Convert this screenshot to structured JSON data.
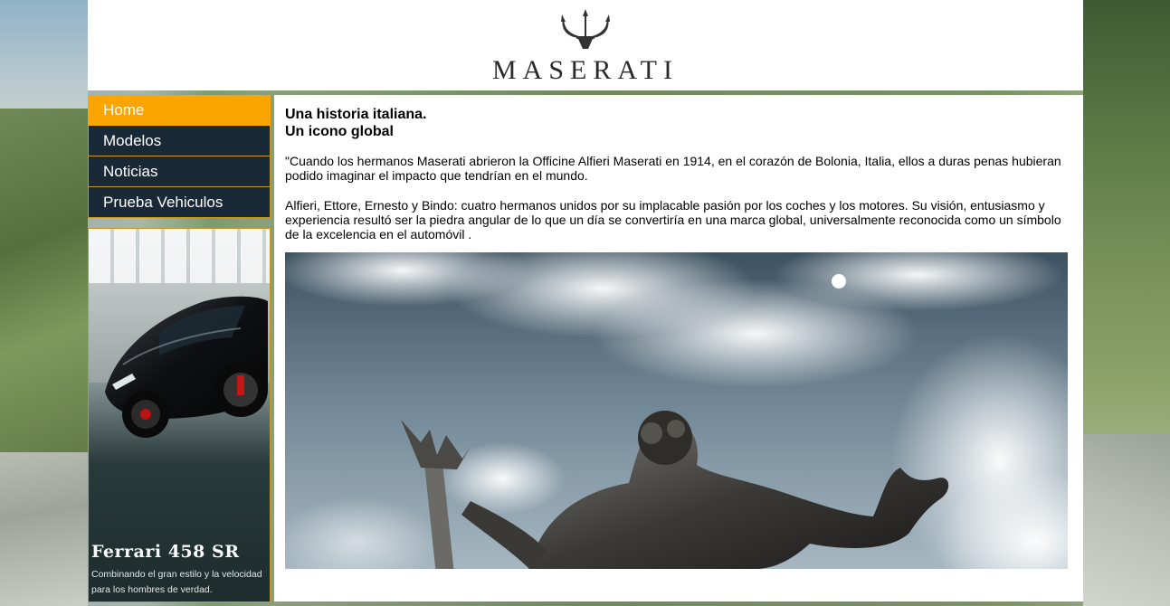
{
  "header": {
    "brand": "MASERATI"
  },
  "nav": {
    "items": [
      {
        "label": "Home",
        "active": true
      },
      {
        "label": "Modelos",
        "active": false
      },
      {
        "label": "Noticias",
        "active": false
      },
      {
        "label": "Prueba Vehiculos",
        "active": false
      }
    ]
  },
  "ad": {
    "title": "Ferrari 458 SR",
    "tagline": "Combinando el gran estilo y la velocidad para los hombres de verdad."
  },
  "content": {
    "heading_line1": "Una historia italiana.",
    "heading_line2": "Un icono global",
    "paragraph1": "\"Cuando los hermanos Maserati abrieron la Officine Alfieri Maserati en 1914, en el corazón de Bolonia, Italia, ellos a duras penas hubieran podido imaginar el impacto que tendrían en el mundo.",
    "paragraph2": "Alfieri, Ettore, Ernesto y Bindo: cuatro hermanos unidos por su implacable pasión por los coches y los motores. Su visión, entusiasmo y experiencia resultó ser la piedra angular de lo que un día se convertiría en una marca global, universalmente reconocida como un símbolo de la excelencia en el automóvil ."
  },
  "colors": {
    "nav_active": "#fca400",
    "nav_bg": "#1a2937",
    "nav_border": "#c8951d"
  }
}
